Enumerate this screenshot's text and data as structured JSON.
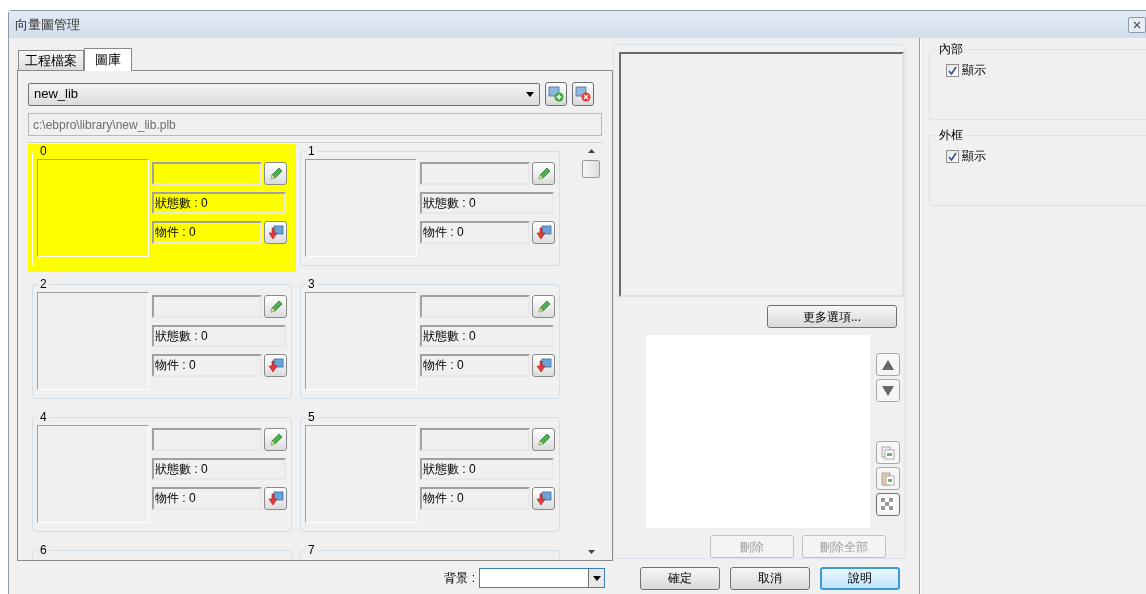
{
  "window": {
    "title": "向量圖管理"
  },
  "tabs": [
    {
      "label": "工程檔案",
      "selected": false
    },
    {
      "label": "圖庫",
      "selected": true
    }
  ],
  "library": {
    "value": "new_lib",
    "path": "c:\\ebpro\\library\\new_lib.plb"
  },
  "cells": [
    {
      "index": "0",
      "states": "狀態數 : 0",
      "objects": "物件 : 0",
      "selected": true
    },
    {
      "index": "1",
      "states": "狀態數 : 0",
      "objects": "物件 : 0",
      "selected": false
    },
    {
      "index": "2",
      "states": "狀態數 : 0",
      "objects": "物件 : 0",
      "selected": false
    },
    {
      "index": "3",
      "states": "狀態數 : 0",
      "objects": "物件 : 0",
      "selected": false
    },
    {
      "index": "4",
      "states": "狀態數 : 0",
      "objects": "物件 : 0",
      "selected": false
    },
    {
      "index": "5",
      "states": "狀態數 : 0",
      "objects": "物件 : 0",
      "selected": false
    },
    {
      "index": "6",
      "selected": false
    },
    {
      "index": "7",
      "selected": false
    }
  ],
  "background": {
    "label": "背景 :"
  },
  "more_button": {
    "label": "更多選項..."
  },
  "list_buttons": [
    {
      "label": "刪除",
      "disabled": true
    },
    {
      "label": "刪除全部",
      "disabled": true
    }
  ],
  "dialog_buttons": [
    {
      "label": "確定",
      "default": false
    },
    {
      "label": "取消",
      "default": false
    },
    {
      "label": "說明",
      "default": true
    }
  ],
  "groups": [
    {
      "title": "內部",
      "checkbox": {
        "label": "顯示",
        "checked": true
      }
    },
    {
      "title": "外框",
      "checkbox": {
        "label": "顯示",
        "checked": true
      }
    }
  ]
}
